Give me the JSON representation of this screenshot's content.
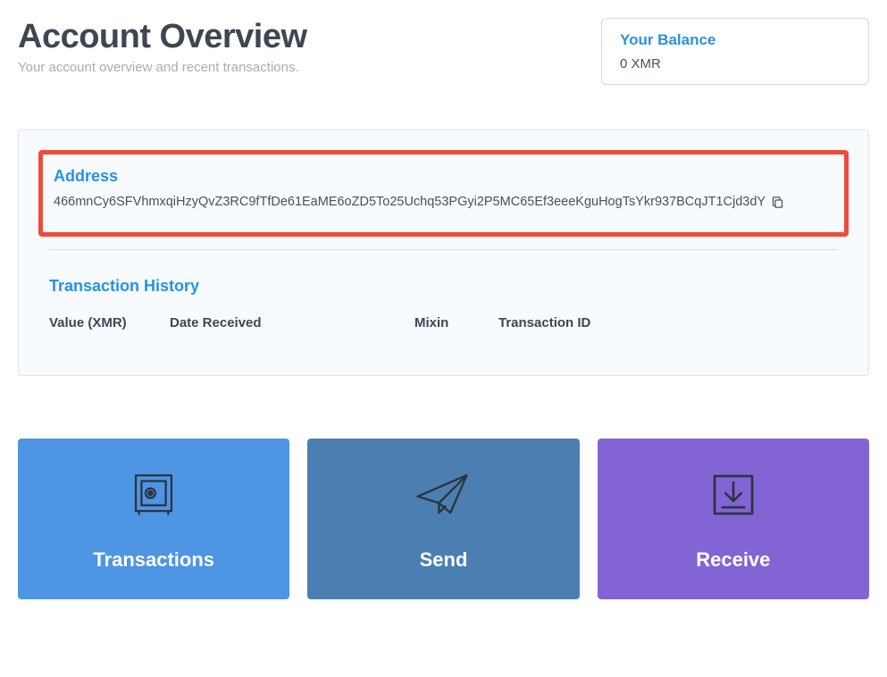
{
  "header": {
    "title": "Account Overview",
    "subtitle": "Your account overview and recent transactions."
  },
  "balance": {
    "label": "Your Balance",
    "value": "0 XMR"
  },
  "address": {
    "label": "Address",
    "value": "466mnCy6SFVhmxqiHzyQvZ3RC9fTfDe61EaME6oZD5To25Uchq53PGyi2P5MC65Ef3eeeKguHogTsYkr937BCqJT1Cjd3dY"
  },
  "history": {
    "label": "Transaction History",
    "columns": {
      "value": "Value (XMR)",
      "date": "Date Received",
      "mixin": "Mixin",
      "txid": "Transaction ID"
    },
    "rows": []
  },
  "actions": {
    "transactions": {
      "label": "Transactions",
      "icon": "safe-icon"
    },
    "send": {
      "label": "Send",
      "icon": "paper-plane-icon"
    },
    "receive": {
      "label": "Receive",
      "icon": "download-icon"
    }
  },
  "colors": {
    "accent": "#2a90e6",
    "highlight": "#ee4b3a",
    "transactions": "#4e95e3",
    "send": "#4b7fb2",
    "receive": "#8364d5"
  }
}
